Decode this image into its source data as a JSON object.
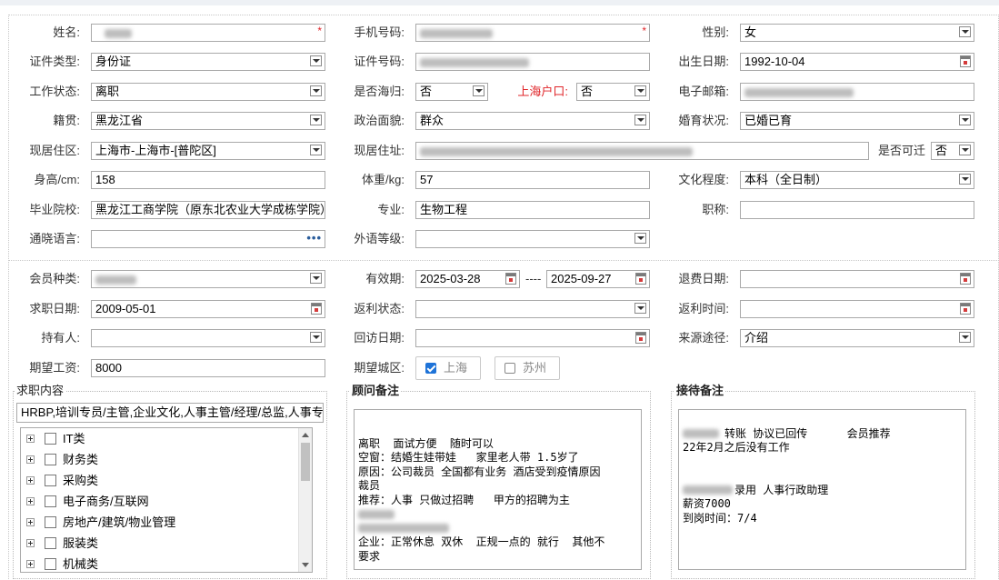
{
  "labels": {
    "name": "姓名:",
    "phone": "手机号码:",
    "gender": "性别:",
    "id_type": "证件类型:",
    "id_no": "证件号码:",
    "birth": "出生日期:",
    "work_status": "工作状态:",
    "overseas": "是否海归:",
    "sh_hukou": "上海户口:",
    "email": "电子邮箱:",
    "native": "籍贯:",
    "political": "政治面貌:",
    "marital": "婚育状况:",
    "residence_area": "现居住区:",
    "residence_addr": "现居住址:",
    "relocate": "是否可迁",
    "height": "身高/cm:",
    "weight": "体重/kg:",
    "education": "文化程度:",
    "school": "毕业院校:",
    "major": "专业:",
    "title": "职称:",
    "languages": "通晓语言:",
    "foreign_level": "外语等级:",
    "member_type": "会员种类:",
    "validity": "有效期:",
    "refund_date": "退费日期:",
    "job_date": "求职日期:",
    "rebate_status": "返利状态:",
    "rebate_time": "返利时间:",
    "holder": "持有人:",
    "visit_date": "回访日期:",
    "source": "来源途径:",
    "salary": "期望工资:",
    "city": "期望城区:"
  },
  "values": {
    "gender": "女",
    "id_type": "身份证",
    "birth": "1992-10-04",
    "work_status": "离职",
    "overseas": "否",
    "sh_hukou": "否",
    "native": "黑龙江省",
    "political": "群众",
    "marital": "已婚已育",
    "residence_area": "上海市-上海市-[普陀区]",
    "relocate": "否",
    "height": "158",
    "weight": "57",
    "education": "本科（全日制）",
    "school": "黑龙江工商学院（原东北农业大学成栋学院）",
    "major": "生物工程",
    "validity_from": "2025-03-28",
    "validity_sep": "----",
    "validity_to": "2025-09-27",
    "job_date": "2009-05-01",
    "source": "介绍",
    "salary": "8000"
  },
  "cities": [
    {
      "label": "上海",
      "checked": true
    },
    {
      "label": "苏州",
      "checked": false
    }
  ],
  "job_content": {
    "title": "求职内容",
    "summary": "HRBP,培训专员/主管,企业文化,人事主管/经理/总监,人事专",
    "categories": [
      "IT类",
      "财务类",
      "采购类",
      "电子商务/互联网",
      "房地产/建筑/物业管理",
      "服装类",
      "机械类"
    ]
  },
  "advisor_note": {
    "title": "顾问备注",
    "lines": [
      "离职  面试方便  随时可以",
      "空窗：结婚生娃带娃   家里老人带 1.5岁了",
      "原因：公司裁员 全国都有业务 酒店受到疫情原因",
      "裁员",
      "推荐：人事 只做过招聘   甲方的招聘为主",
      "",
      "",
      "企业：正常休息 双休  正规一点的 就行  其他不",
      "要求"
    ]
  },
  "reception_note": {
    "title": "接待备注",
    "lines": [
      "转账 协议已回传      会员推荐",
      "22年2月之后没有工作",
      "",
      "",
      "录用 人事行政助理",
      "薪资7000",
      "到岗时间：7/4"
    ]
  },
  "required_mark": "*",
  "more_glyph": "•••"
}
